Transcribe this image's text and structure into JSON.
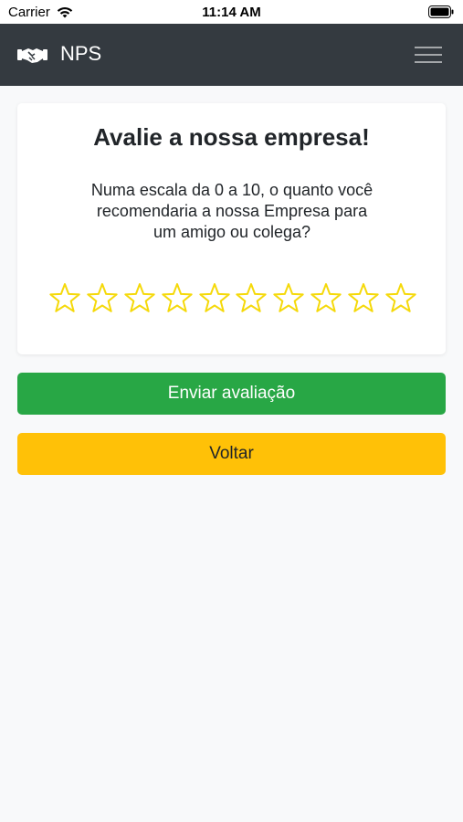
{
  "status_bar": {
    "carrier": "Carrier",
    "time": "11:14 AM",
    "wifi_icon": "wifi-icon",
    "battery_icon": "battery-icon"
  },
  "navbar": {
    "brand": "NPS",
    "brand_icon": "handshake-icon",
    "menu_icon": "hamburger-menu-icon",
    "background": "#343a40"
  },
  "card": {
    "title": "Avalie a nossa empresa!",
    "question": "Numa escala da 0 a 10, o quanto você recomendaria a nossa Empresa para um amigo ou colega?",
    "rating": {
      "count": 10,
      "selected": 0,
      "star_color": "#f5d90a",
      "icon": "star-outline-icon"
    }
  },
  "actions": {
    "submit_label": "Enviar avaliação",
    "submit_color": "#28a745",
    "back_label": "Voltar",
    "back_color": "#ffc107"
  }
}
